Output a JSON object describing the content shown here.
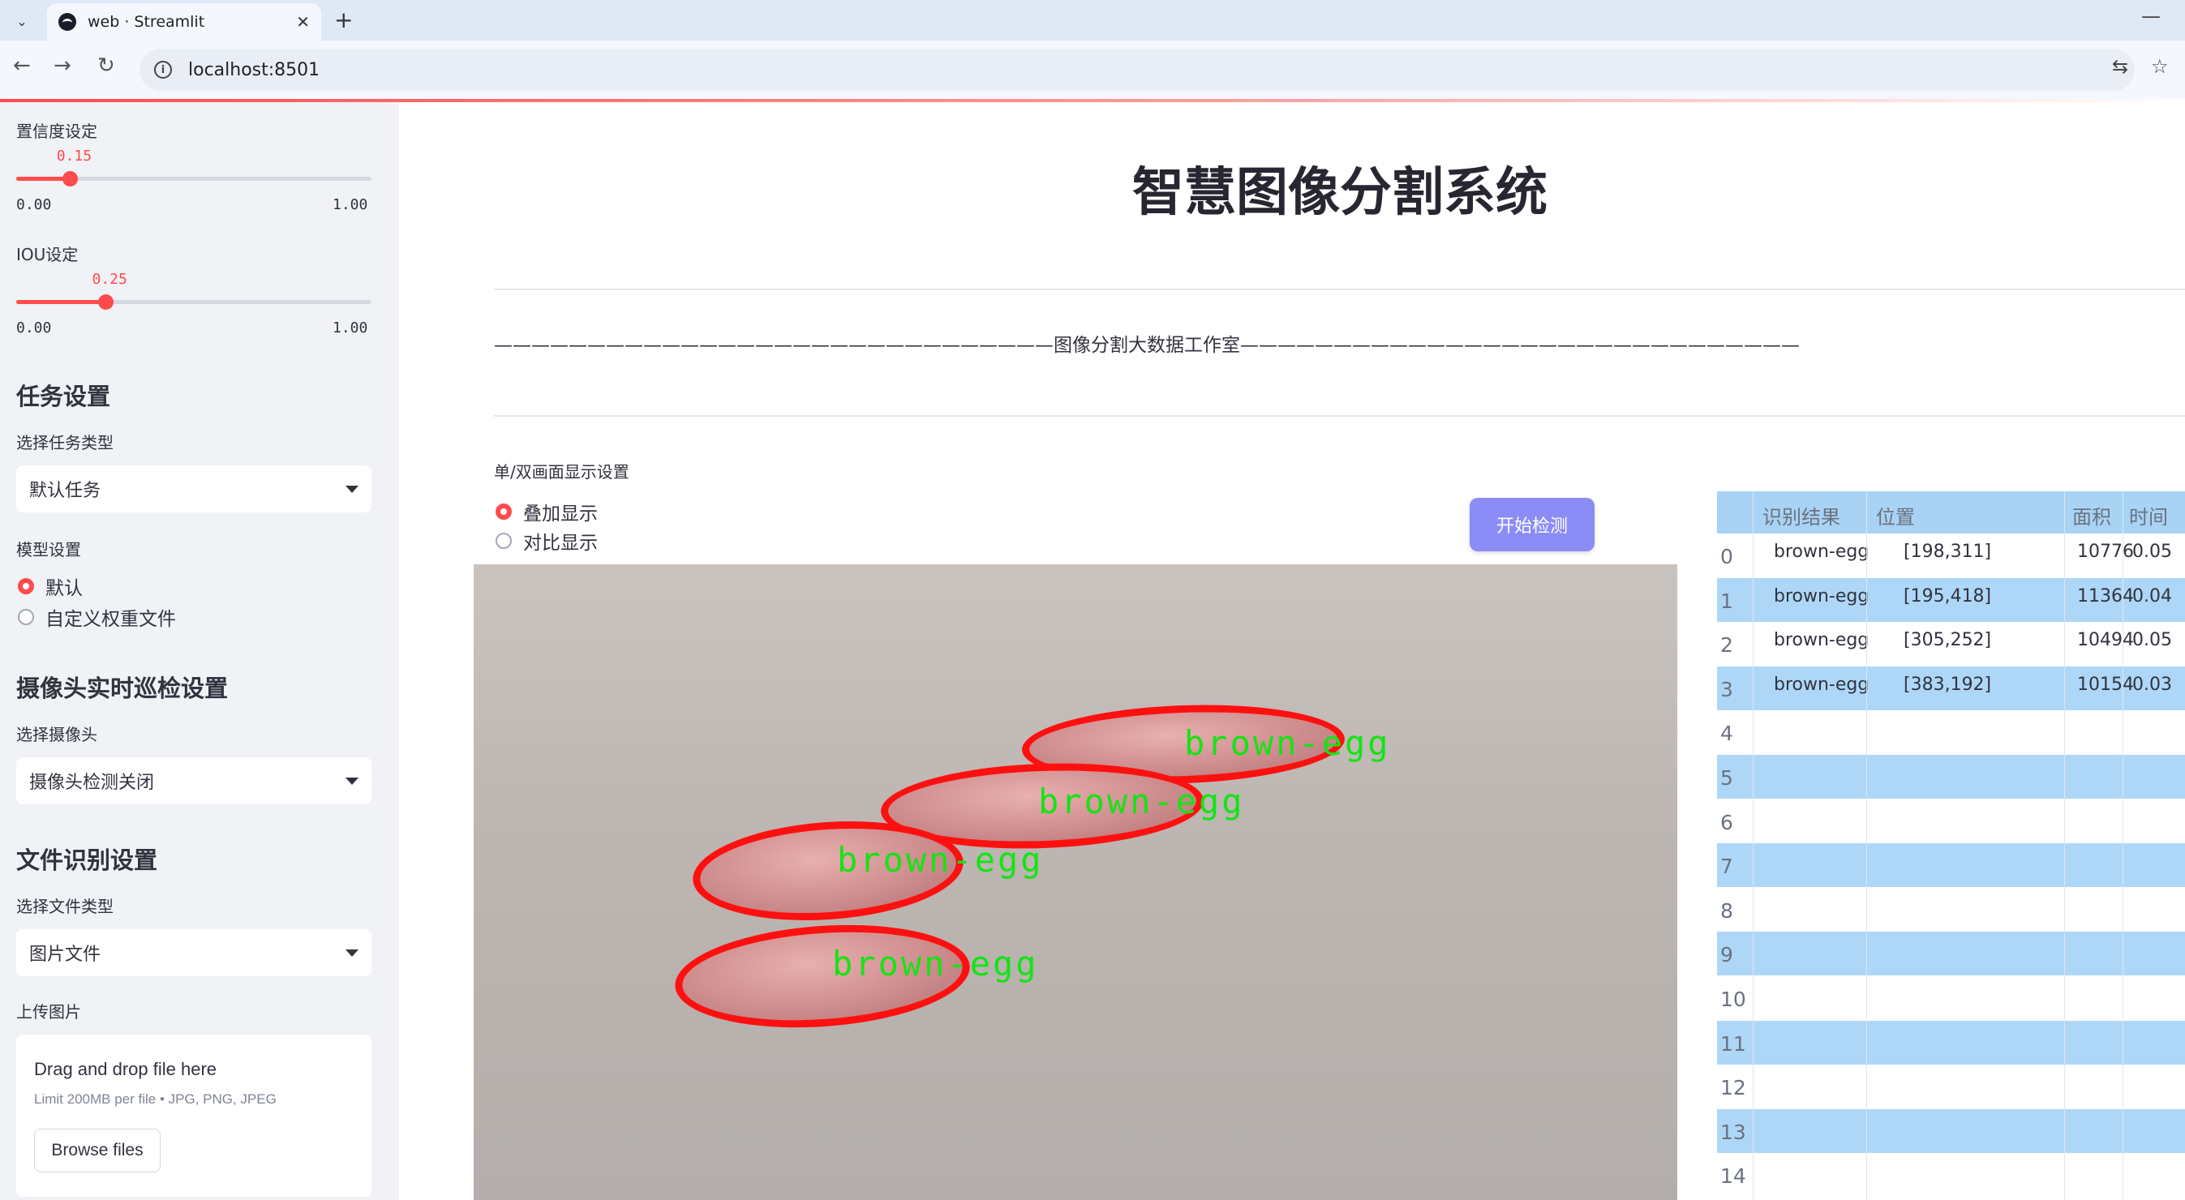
{
  "browser": {
    "tab_title": "web · Streamlit",
    "url": "localhost:8501"
  },
  "sidebar": {
    "confidence": {
      "label": "置信度设定",
      "value": "0.15",
      "value_num": 0.15,
      "min": "0.00",
      "max": "1.00"
    },
    "iou": {
      "label": "IOU设定",
      "value": "0.25",
      "value_num": 0.25,
      "min": "0.00",
      "max": "1.00"
    },
    "task_header": "任务设置",
    "task_type_label": "选择任务类型",
    "task_type_value": "默认任务",
    "model_label": "模型设置",
    "model_options": [
      "默认",
      "自定义权重文件"
    ],
    "model_selected": 0,
    "camera_header": "摄像头实时巡检设置",
    "camera_label": "选择摄像头",
    "camera_value": "摄像头检测关闭",
    "file_header": "文件识别设置",
    "file_type_label": "选择文件类型",
    "file_type_value": "图片文件",
    "upload_label": "上传图片",
    "upload_drag": "Drag and drop file here",
    "upload_limit": "Limit 200MB per file • JPG, PNG, JPEG",
    "upload_button": "Browse files"
  },
  "main": {
    "title": "智慧图像分割系统",
    "banner": "——————————————————————————————图像分割大数据工作室——————————————————————————————",
    "display_label": "单/双画面显示设置",
    "display_options": [
      "叠加显示",
      "对比显示"
    ],
    "display_selected": 0,
    "start_button": "开始检测",
    "detections": [
      {
        "label": "brown-egg"
      },
      {
        "label": "brown-egg"
      },
      {
        "label": "brown-egg"
      },
      {
        "label": "brown-egg"
      }
    ]
  },
  "table": {
    "columns": [
      "识别结果",
      "位置",
      "面积",
      "时间"
    ],
    "rows": [
      {
        "index": "0",
        "result": "brown-egg",
        "position": "[198,311]",
        "area": "10776",
        "time": "0.05"
      },
      {
        "index": "1",
        "result": "brown-egg",
        "position": "[195,418]",
        "area": "11364",
        "time": "0.04"
      },
      {
        "index": "2",
        "result": "brown-egg",
        "position": "[305,252]",
        "area": "10494",
        "time": "0.05"
      },
      {
        "index": "3",
        "result": "brown-egg",
        "position": "[383,192]",
        "area": "10154",
        "time": "0.03"
      },
      {
        "index": "4"
      },
      {
        "index": "5"
      },
      {
        "index": "6"
      },
      {
        "index": "7"
      },
      {
        "index": "8"
      },
      {
        "index": "9"
      },
      {
        "index": "10"
      },
      {
        "index": "11"
      },
      {
        "index": "12"
      },
      {
        "index": "13"
      },
      {
        "index": "14"
      }
    ]
  },
  "colors": {
    "accent": "#ff4b4b",
    "button": "#8b8cf5",
    "table_header": "#a9d3f5",
    "table_alt_row": "#aed7f7",
    "mask_outline": "#ff1010",
    "label_text": "#14e414"
  }
}
